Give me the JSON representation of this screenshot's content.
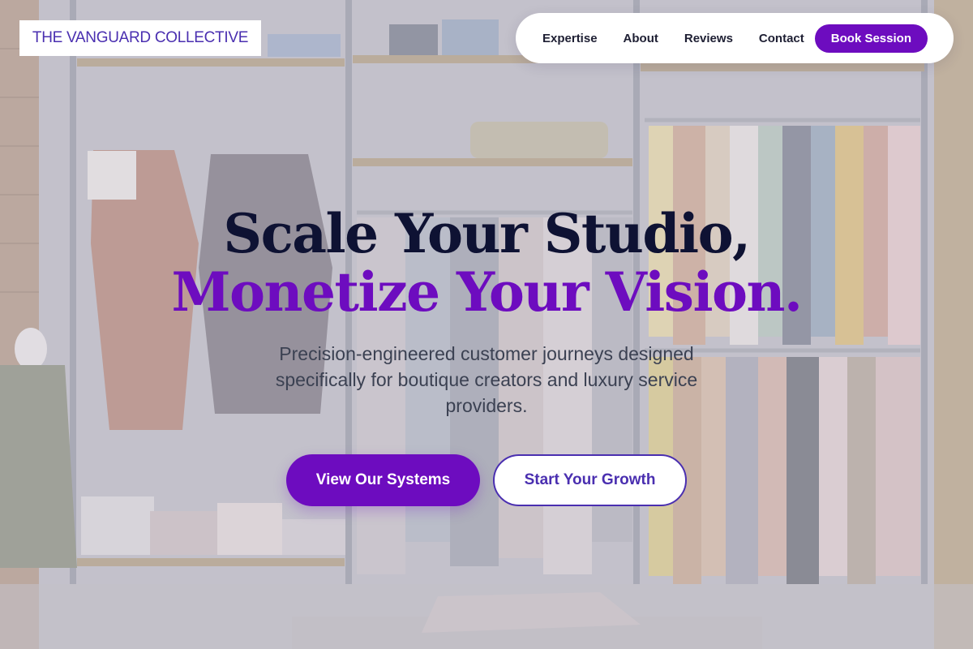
{
  "brand": {
    "logo_text": "THE VANGUARD COLLECTIVE"
  },
  "nav": {
    "links": [
      "Expertise",
      "About",
      "Reviews",
      "Contact"
    ],
    "cta_label": "Book Session"
  },
  "hero": {
    "headline_line1": "Scale Your Studio,",
    "headline_line2": "Monetize Your Vision.",
    "subheadline": "Precision-engineered customer journeys designed specifically for boutique creators and luxury service providers.",
    "primary_button": "View Our Systems",
    "secondary_button": "Start Your Growth"
  },
  "colors": {
    "accent": "#6d0cbf",
    "logo_text": "#4a2fb0",
    "headline_dark": "#0e1233",
    "body_text": "#3b4152"
  }
}
